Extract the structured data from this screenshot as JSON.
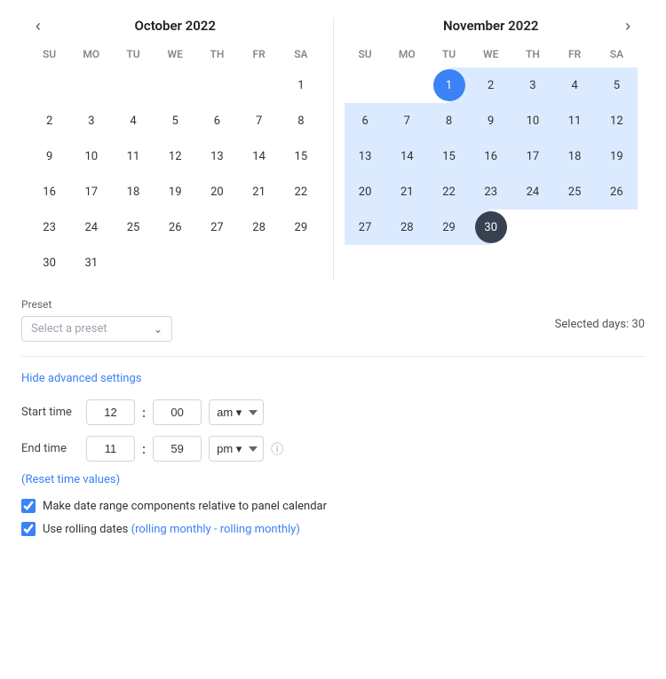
{
  "october": {
    "title": "October  2022",
    "days_header": [
      "SU",
      "MO",
      "TU",
      "WE",
      "TH",
      "FR",
      "SA"
    ],
    "weeks": [
      [
        null,
        null,
        null,
        null,
        null,
        null,
        1
      ],
      [
        2,
        3,
        4,
        5,
        6,
        7,
        8
      ],
      [
        9,
        10,
        11,
        12,
        13,
        14,
        15
      ],
      [
        16,
        17,
        18,
        19,
        20,
        21,
        22
      ],
      [
        23,
        24,
        25,
        26,
        27,
        28,
        29
      ],
      [
        30,
        31,
        null,
        null,
        null,
        null,
        null
      ]
    ]
  },
  "november": {
    "title": "November  2022",
    "days_header": [
      "SU",
      "MO",
      "TU",
      "WE",
      "TH",
      "FR",
      "SA"
    ],
    "weeks": [
      [
        null,
        null,
        1,
        2,
        3,
        4,
        5
      ],
      [
        6,
        7,
        8,
        9,
        10,
        11,
        12
      ],
      [
        13,
        14,
        15,
        16,
        17,
        18,
        19
      ],
      [
        20,
        21,
        22,
        23,
        24,
        25,
        26
      ],
      [
        27,
        28,
        29,
        30,
        null,
        null,
        null
      ]
    ],
    "today": 1,
    "selected_end": 30
  },
  "preset": {
    "label": "Preset",
    "placeholder": "Select a preset",
    "selected_days_label": "Selected days: 30"
  },
  "advanced": {
    "link_label": "Hide advanced settings"
  },
  "start_time": {
    "label": "Start time",
    "hour": "12",
    "minute": "00",
    "period": "am",
    "period_options": [
      "am",
      "pm"
    ]
  },
  "end_time": {
    "label": "End time",
    "hour": "11",
    "minute": "59",
    "period": "pm",
    "period_options": [
      "am",
      "pm"
    ]
  },
  "reset_link": "(Reset time values)",
  "checkboxes": [
    {
      "id": "relative-checkbox",
      "label": "Make date range components relative to panel calendar",
      "checked": true
    },
    {
      "id": "rolling-checkbox",
      "label_prefix": "Use rolling dates ",
      "label_link": "(rolling monthly - rolling monthly)",
      "checked": true
    }
  ],
  "nav": {
    "prev": "‹",
    "next": "›"
  }
}
